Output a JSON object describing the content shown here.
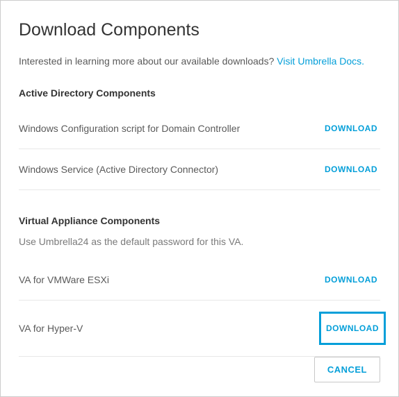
{
  "title": "Download Components",
  "intro": {
    "text": "Interested in learning more about our available downloads?  ",
    "link": "Visit Umbrella Docs."
  },
  "sections": [
    {
      "header": "Active Directory Components",
      "items": [
        {
          "label": "Windows Configuration script for Domain Controller",
          "action": "DOWNLOAD"
        },
        {
          "label": "Windows Service (Active Directory Connector)",
          "action": "DOWNLOAD"
        }
      ]
    },
    {
      "header": "Virtual Appliance Components",
      "sub": "Use Umbrella24 as the default password for this VA.",
      "items": [
        {
          "label": "VA for VMWare ESXi",
          "action": "DOWNLOAD"
        },
        {
          "label": "VA for Hyper-V",
          "action": "DOWNLOAD",
          "highlight": true
        }
      ]
    }
  ],
  "footer": {
    "cancel": "CANCEL"
  }
}
